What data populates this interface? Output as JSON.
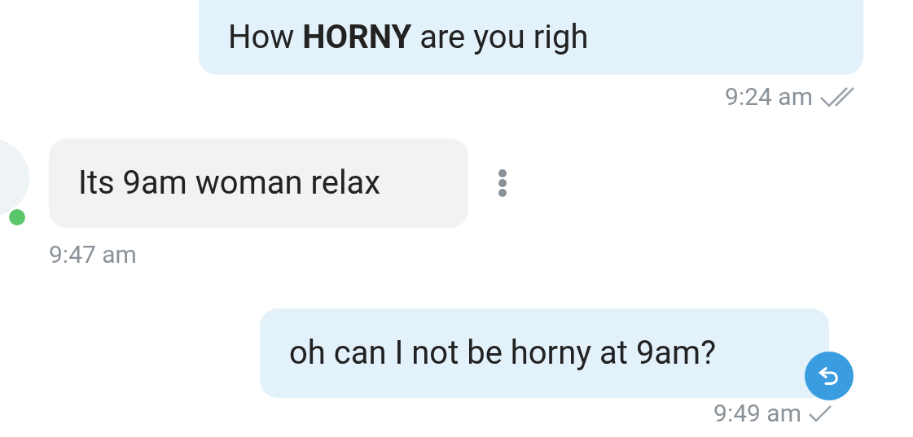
{
  "messages": [
    {
      "kind": "sent",
      "text": "How **HORNY** are you righ",
      "time": "9:24 am",
      "read": true
    },
    {
      "kind": "received",
      "text": "Its 9am woman relax",
      "time": "9:47 am",
      "online": true
    },
    {
      "kind": "sent",
      "text": "oh can I not be horny at 9am?",
      "time": "9:49 am",
      "read": false,
      "undo": true
    }
  ]
}
